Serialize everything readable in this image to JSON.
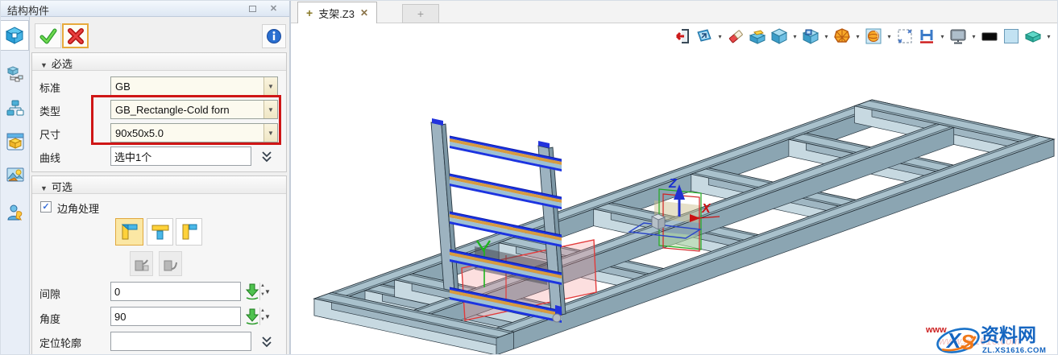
{
  "panel": {
    "title": "结构构件",
    "actions": {
      "confirm": "ok-check",
      "cancel": "cancel-x",
      "info": "info-circle"
    },
    "required_section": {
      "collapse_icon": "▼",
      "label": "必选"
    },
    "optional_section": {
      "collapse_icon": "▼",
      "label": "可选"
    },
    "fields": {
      "standard": {
        "label": "标准",
        "value": "GB"
      },
      "type": {
        "label": "类型",
        "value": "GB_Rectangle-Cold forn"
      },
      "size": {
        "label": "尺寸",
        "value": "90x50x5.0"
      },
      "curve": {
        "label": "曲线",
        "value": "选中1个"
      },
      "corner": {
        "label": "边角处理",
        "checked": true,
        "checked_glyph": "✓"
      },
      "gap": {
        "label": "间隙",
        "value": "0"
      },
      "angle": {
        "label": "角度",
        "value": "90"
      },
      "profile": {
        "label": "定位轮廓",
        "value": ""
      }
    },
    "spinner": {
      "up": "▲",
      "down": "▼"
    },
    "dropdown_glyph": "▼"
  },
  "sidebar_icons": [
    "shape-manager-cube",
    "history-tree",
    "assembly-hierarchy",
    "visual-manager",
    "render-image",
    "user-role"
  ],
  "tabbar": {
    "active_tab": {
      "prefix": "+",
      "label": "支架.Z3",
      "close": "✕"
    },
    "new_tab_label": "+"
  },
  "toolbar_icons": [
    "exit",
    "view-plane",
    "eraser",
    "open-box",
    "shaded-cube",
    "cube-preview",
    "wireframe-sphere",
    "zoom-all",
    "zoom-window",
    "section-beam",
    "display-monitor",
    "black-swatch",
    "blue-swatch",
    "render-material"
  ],
  "viewport": {
    "z_axis_label": "Z",
    "x_axis_label": "X"
  },
  "watermark": {
    "www": "www",
    "logo_x": "X",
    "logo_s": "S",
    "site": "资料网",
    "url": "ZL.XS1616.COM"
  }
}
